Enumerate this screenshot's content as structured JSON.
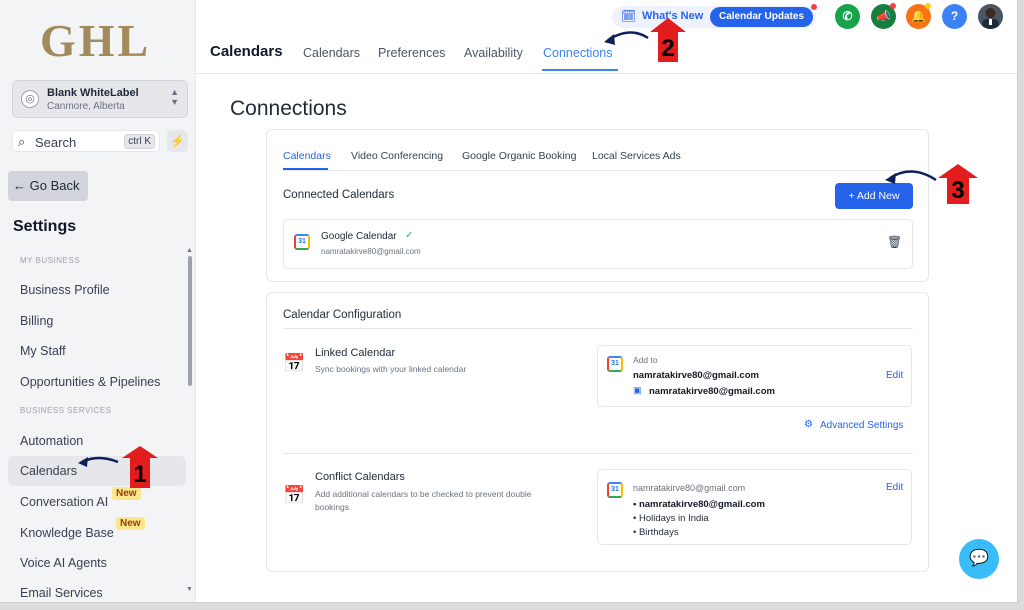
{
  "sidebar": {
    "logo": "GHL",
    "account_name": "Blank WhiteLabel",
    "account_location": "Canmore, Alberta",
    "search_label": "Search",
    "search_shortcut": "ctrl K",
    "go_back": "← Go Back",
    "settings_title": "Settings",
    "section_my_business": "MY BUSINESS",
    "section_business_services": "BUSINESS SERVICES",
    "items": [
      "Business Profile",
      "Billing",
      "My Staff",
      "Opportunities & Pipelines",
      "Automation",
      "Calendars",
      "Conversation AI",
      "Knowledge Base",
      "Voice AI Agents",
      "Email Services"
    ],
    "new_badge": "New"
  },
  "header": {
    "title": "Calendars",
    "tabs": [
      "Calendars",
      "Preferences",
      "Availability",
      "Connections"
    ],
    "whats_new": "What's New",
    "calendar_updates": "Calendar Updates",
    "help": "?"
  },
  "main": {
    "page_title": "Connections",
    "tabs": [
      "Calendars",
      "Video Conferencing",
      "Google Organic Booking",
      "Local Services Ads"
    ],
    "connected_calendars": "Connected Calendars",
    "add_new": "+ Add New",
    "google_calendar": "Google Calendar",
    "google_email": "namratakirve80@gmail.com",
    "calendar_configuration": "Calendar Configuration",
    "linked_title": "Linked Calendar",
    "linked_desc": "Sync bookings with your linked calendar",
    "add_to": "Add to",
    "linked_email": "namratakirve80@gmail.com",
    "linked_cal": "namratakirve80@gmail.com",
    "edit": "Edit",
    "advanced_settings": "Advanced Settings",
    "conflict_title": "Conflict Calendars",
    "conflict_desc_1": "Add additional calendars to be checked to prevent double",
    "conflict_desc_2": "bookings",
    "conflict_email": "namratakirve80@gmail.com",
    "conflict_items": [
      "namratakirve80@gmail.com",
      "Holidays in India",
      "Birthdays"
    ]
  },
  "annotations": [
    "1",
    "2",
    "3"
  ],
  "colors": {
    "accent": "#2563eb",
    "annotation": "#e11d1d"
  }
}
